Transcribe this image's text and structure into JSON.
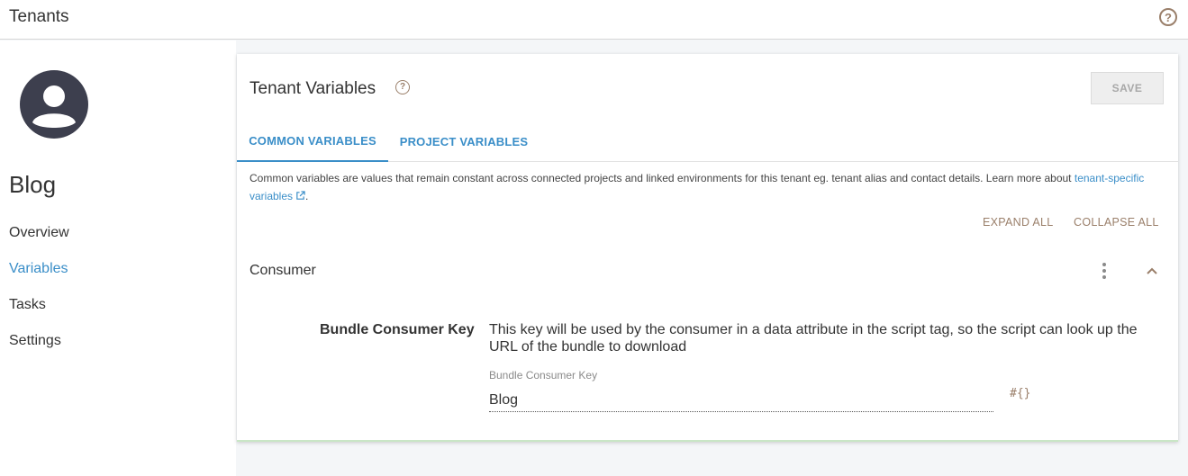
{
  "header": {
    "title": "Tenants",
    "help_icon": "question-circle-icon"
  },
  "sidebar": {
    "tenant_name": "Blog",
    "avatar_icon": "user-avatar-icon",
    "items": [
      {
        "label": "Overview",
        "active": false
      },
      {
        "label": "Variables",
        "active": true
      },
      {
        "label": "Tasks",
        "active": false
      },
      {
        "label": "Settings",
        "active": false
      }
    ]
  },
  "panel": {
    "title": "Tenant Variables",
    "help_icon": "question-circle-icon",
    "save_label": "SAVE",
    "tabs": [
      {
        "label": "COMMON VARIABLES",
        "active": true
      },
      {
        "label": "PROJECT VARIABLES",
        "active": false
      }
    ],
    "description": "Common variables are values that remain constant across connected projects and linked environments for this tenant eg. tenant alias and contact details. Learn more about ",
    "description_link": "tenant-specific variables",
    "description_end": ".",
    "expand_all": "EXPAND ALL",
    "collapse_all": "COLLAPSE ALL",
    "group": {
      "title": "Consumer",
      "variable": {
        "name": "Bundle Consumer Key",
        "description": "This key will be used by the consumer in a data attribute in the script tag, so the script can look up the URL of the bundle to download",
        "field_label": "Bundle Consumer Key",
        "value": "Blog",
        "insert_variable_symbol": "#{}"
      }
    }
  },
  "colors": {
    "accent": "#3a8ec8",
    "muted_brown": "#9a7f6a",
    "avatar": "#3d3f4e"
  }
}
